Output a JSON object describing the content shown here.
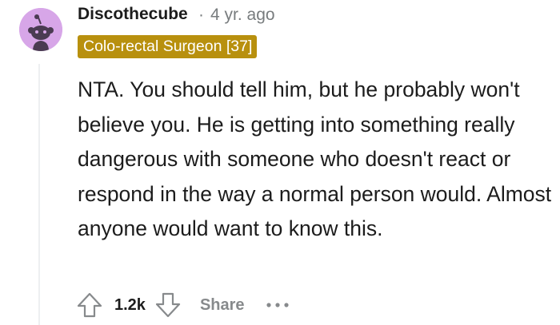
{
  "comment": {
    "author": "Discothecube",
    "separator": "·",
    "age": "4 yr. ago",
    "flair": "Colo-rectal Surgeon [37]",
    "body": "NTA. You should tell him, but he probably won't believe you. He is getting into something really dangerous with someone who doesn't react or respond in the way a normal person would. Almost anyone would want to know this.",
    "avatar_icon": "reddit-snoo-avatar",
    "avatar_color": "#d7a6e8",
    "flair_color": "#b8900e"
  },
  "actions": {
    "upvote_icon": "upvote-arrow-icon",
    "score": "1.2k",
    "downvote_icon": "downvote-arrow-icon",
    "share_label": "Share",
    "more_icon": "more-options-icon"
  }
}
